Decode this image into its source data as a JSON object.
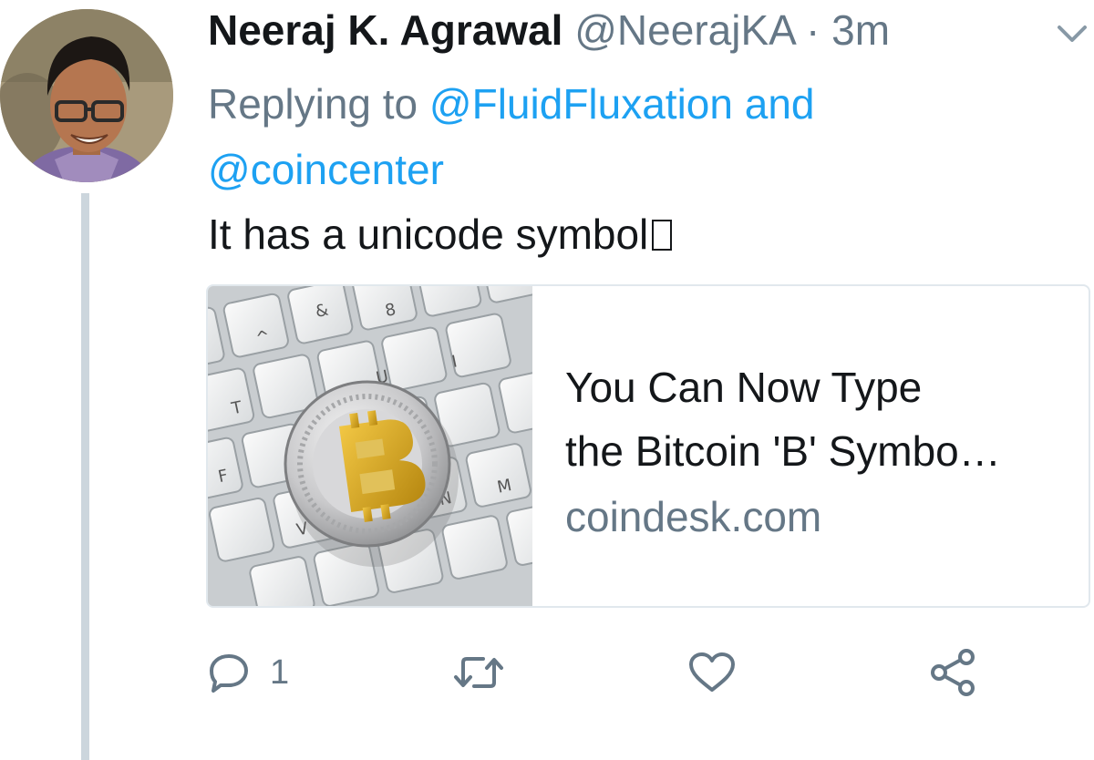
{
  "tweet": {
    "display_name": "Neeraj K. Agrawal",
    "handle": "@NeerajKA",
    "separator": "·",
    "time": "3m",
    "replying_prefix": "Replying to",
    "mention_1": "@FluidFluxation",
    "mention_joiner": "and",
    "mention_2": "@coincenter",
    "text": "It has a unicode symbol"
  },
  "card": {
    "title_line_1": "You Can Now Type",
    "title_line_2": "the Bitcoin 'B' Symbo…",
    "domain": "coindesk.com",
    "image_subject": "bitcoin coin on keyboard"
  },
  "actions": {
    "reply_count": "1",
    "icons": [
      "reply-icon",
      "retweet-icon",
      "like-icon",
      "share-icon"
    ]
  },
  "colors": {
    "link": "#1da1f2",
    "muted": "#657786",
    "text": "#14171a",
    "thread_line": "#ccd6dd"
  }
}
